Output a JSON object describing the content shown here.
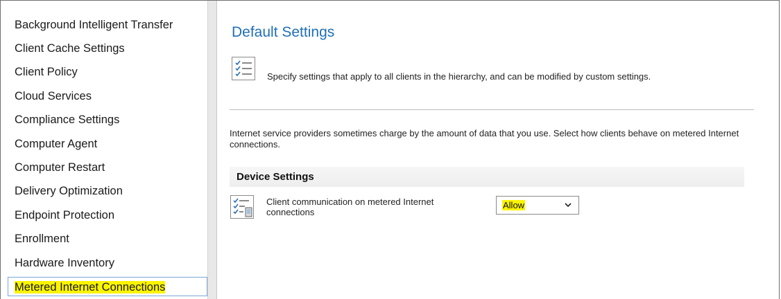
{
  "sidebar": {
    "items": [
      {
        "label": "Background Intelligent Transfer"
      },
      {
        "label": "Client Cache Settings"
      },
      {
        "label": "Client Policy"
      },
      {
        "label": "Cloud Services"
      },
      {
        "label": "Compliance Settings"
      },
      {
        "label": "Computer Agent"
      },
      {
        "label": "Computer Restart"
      },
      {
        "label": "Delivery Optimization"
      },
      {
        "label": "Endpoint Protection"
      },
      {
        "label": "Enrollment"
      },
      {
        "label": "Hardware Inventory"
      },
      {
        "label": "Metered Internet Connections",
        "selected": true
      }
    ]
  },
  "main": {
    "title": "Default Settings",
    "description": "Specify settings that apply to all clients in the hierarchy, and can be modified by custom settings.",
    "info": "Internet service providers sometimes charge by the amount of data that you use. Select how clients behave on metered Internet connections.",
    "section": {
      "title": "Device Settings",
      "setting_label": "Client communication on metered Internet connections",
      "setting_value": "Allow"
    }
  },
  "colors": {
    "highlight": "#fbf400",
    "title": "#1f6fb6",
    "selection_border": "#7aa7d9"
  },
  "icons": {
    "settings_list": "checklist-icon",
    "device_setting": "checklist-device-icon",
    "dropdown": "chevron-down-icon"
  }
}
